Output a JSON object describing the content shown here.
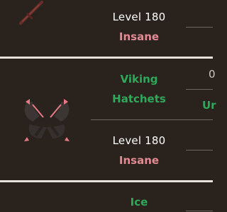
{
  "rows": [
    {
      "level": "Level 180",
      "difficulty": "Insane"
    },
    {
      "name_line1": "Viking",
      "name_line2": "Hatchets",
      "level": "Level 180",
      "difficulty": "Insane",
      "side_top": "0",
      "side_status": "Ur"
    },
    {
      "name_line1": "Ice"
    }
  ],
  "icons": {
    "row1": "sword-icon",
    "row2": "crossed-hatchets-icon"
  },
  "colors": {
    "background": "#2a231d",
    "difficulty": "#e48a94",
    "weapon_name": "#2ea85a",
    "divider": "#e8e2dc"
  }
}
